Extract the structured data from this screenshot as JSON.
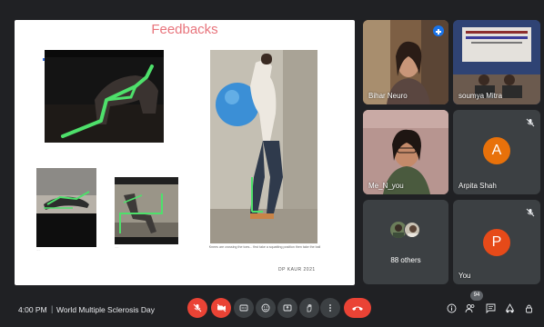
{
  "slide": {
    "title": "Feedbacks",
    "caption": "Knees are crossing the toes... first take a squatting position then take the ball",
    "signature": "DP KAUR 2021",
    "small_caption_1": "......",
    "small_caption_2": "......"
  },
  "participants": [
    {
      "name": "Bihar Neuro",
      "has_pin": true
    },
    {
      "name": "soumya Mitra"
    },
    {
      "name": "Me_N_you"
    },
    {
      "name": "Arpita Shah",
      "initial": "A",
      "avatar_color": "#e8710a",
      "muted": true
    },
    {
      "name": "88 others"
    },
    {
      "name": "You",
      "initial": "P",
      "avatar_color": "#e64a19",
      "muted": true
    }
  ],
  "bottom_bar": {
    "time": "4:00 PM",
    "separator": "|",
    "meeting_title": "World Multiple Sclerosis Day",
    "participant_count": "94"
  },
  "colors": {
    "background": "#202124",
    "tile": "#3c4043",
    "danger": "#ea4335",
    "title_pink": "#e8747c",
    "accent_blue": "#1a73e8"
  }
}
